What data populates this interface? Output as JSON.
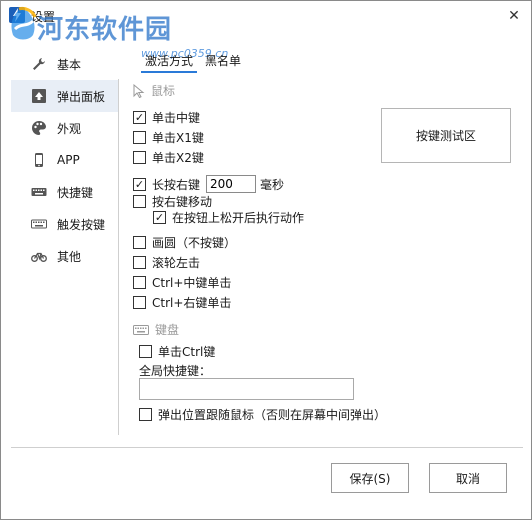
{
  "window": {
    "title": "设置",
    "close_glyph": "✕"
  },
  "watermark": {
    "text": "河东软件园",
    "url": "www.pc0359.cn"
  },
  "sidebar": {
    "items": [
      {
        "label": "基本",
        "icon": "wrench-icon"
      },
      {
        "label": "弹出面板",
        "icon": "popup-panel-icon"
      },
      {
        "label": "外观",
        "icon": "palette-icon"
      },
      {
        "label": "APP",
        "icon": "phone-icon"
      },
      {
        "label": "快捷键",
        "icon": "keyboard-icon"
      },
      {
        "label": "触发按键",
        "icon": "keyboard-icon"
      },
      {
        "label": "其他",
        "icon": "bicycle-icon"
      }
    ],
    "active_index": 1
  },
  "tabs": [
    {
      "label": "激活方式"
    },
    {
      "label": "黑名单"
    }
  ],
  "mouse_section": {
    "title": "鼠标",
    "options": {
      "middle_click": {
        "label": "单击中键",
        "checked": true
      },
      "x1_click": {
        "label": "单击X1键",
        "checked": false
      },
      "x2_click": {
        "label": "单击X2键",
        "checked": false
      },
      "long_right": {
        "label": "长按右键",
        "checked": true,
        "value": "200",
        "unit": "毫秒"
      },
      "right_move": {
        "label": "按右键移动",
        "checked": false
      },
      "release_action": {
        "label": "在按钮上松开后执行动作",
        "checked": true
      },
      "draw_circle": {
        "label": "画圆（不按键）",
        "checked": false
      },
      "wheel_left": {
        "label": "滚轮左击",
        "checked": false
      },
      "ctrl_middle": {
        "label": "Ctrl+中键单击",
        "checked": false
      },
      "ctrl_right": {
        "label": "Ctrl+右键单击",
        "checked": false
      }
    },
    "test_area_label": "按键测试区"
  },
  "keyboard_section": {
    "title": "键盘",
    "ctrl_click": {
      "label": "单击Ctrl键",
      "checked": false
    },
    "hotkey_label": "全局快捷键：",
    "hotkey_value": "",
    "follow_mouse": {
      "label": "弹出位置跟随鼠标（否则在屏幕中间弹出）",
      "checked": false
    }
  },
  "buttons": {
    "save": "保存(S)",
    "cancel": "取消"
  },
  "colors": {
    "accent": "#2a7ad8",
    "watermark": "#2a74c9",
    "active_sidebar_bg": "#e8eef6"
  }
}
